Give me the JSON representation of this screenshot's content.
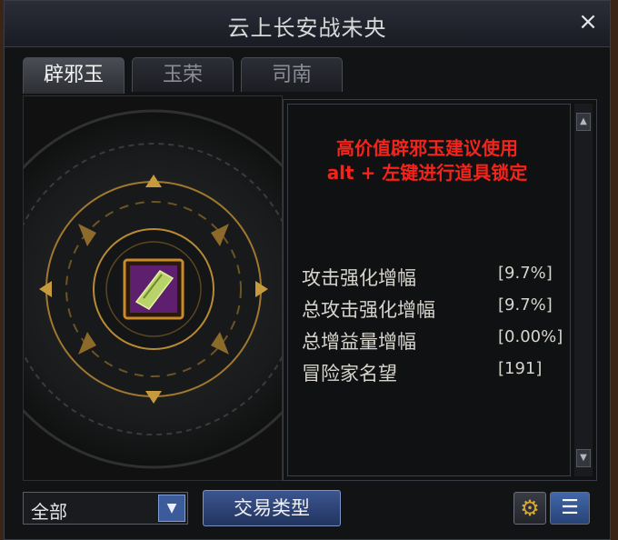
{
  "window": {
    "title": "云上长安战未央",
    "close_icon": "×"
  },
  "tabs": [
    {
      "label": "辟邪玉",
      "active": true
    },
    {
      "label": "玉荣",
      "active": false
    },
    {
      "label": "司南",
      "active": false
    }
  ],
  "item": {
    "icon": "jade-amulet-icon",
    "border_color": "#c98a2a"
  },
  "warning": {
    "line1": "高价值辟邪玉建议使用",
    "line2": "alt + 左键进行道具锁定",
    "color": "#f4231b"
  },
  "stats": [
    {
      "name": "攻击强化增幅",
      "value": "[9.7%]"
    },
    {
      "name": "总攻击强化增幅",
      "value": "[9.7%]"
    },
    {
      "name": "总增益量增幅",
      "value": "[0.00%]"
    },
    {
      "name": "冒险家名望",
      "value": "[191]"
    }
  ],
  "filter": {
    "selected": "全部"
  },
  "buttons": {
    "trade_type": "交易类型"
  },
  "icons": {
    "settings": "gear-icon",
    "list": "list-icon",
    "dropdown": "chevron-down-icon"
  }
}
